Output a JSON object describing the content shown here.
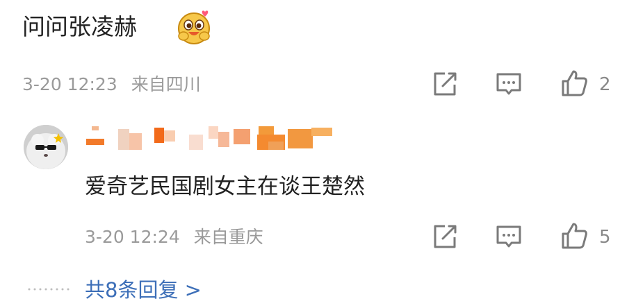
{
  "comment": {
    "text": "问问张凌赫",
    "emoji_icon": "hug-emoji",
    "time": "3-20 12:23",
    "location": "来自四川",
    "like_count": "2"
  },
  "reply": {
    "text": "爱奇艺民国剧女主在谈王楚然",
    "time": "3-20 12:24",
    "location": "来自重庆",
    "like_count": "5"
  },
  "more_replies": "共8条回复 >",
  "colors": {
    "link": "#3d6fb8",
    "meta": "#9a9a9a",
    "icon": "#7a7a7a"
  }
}
